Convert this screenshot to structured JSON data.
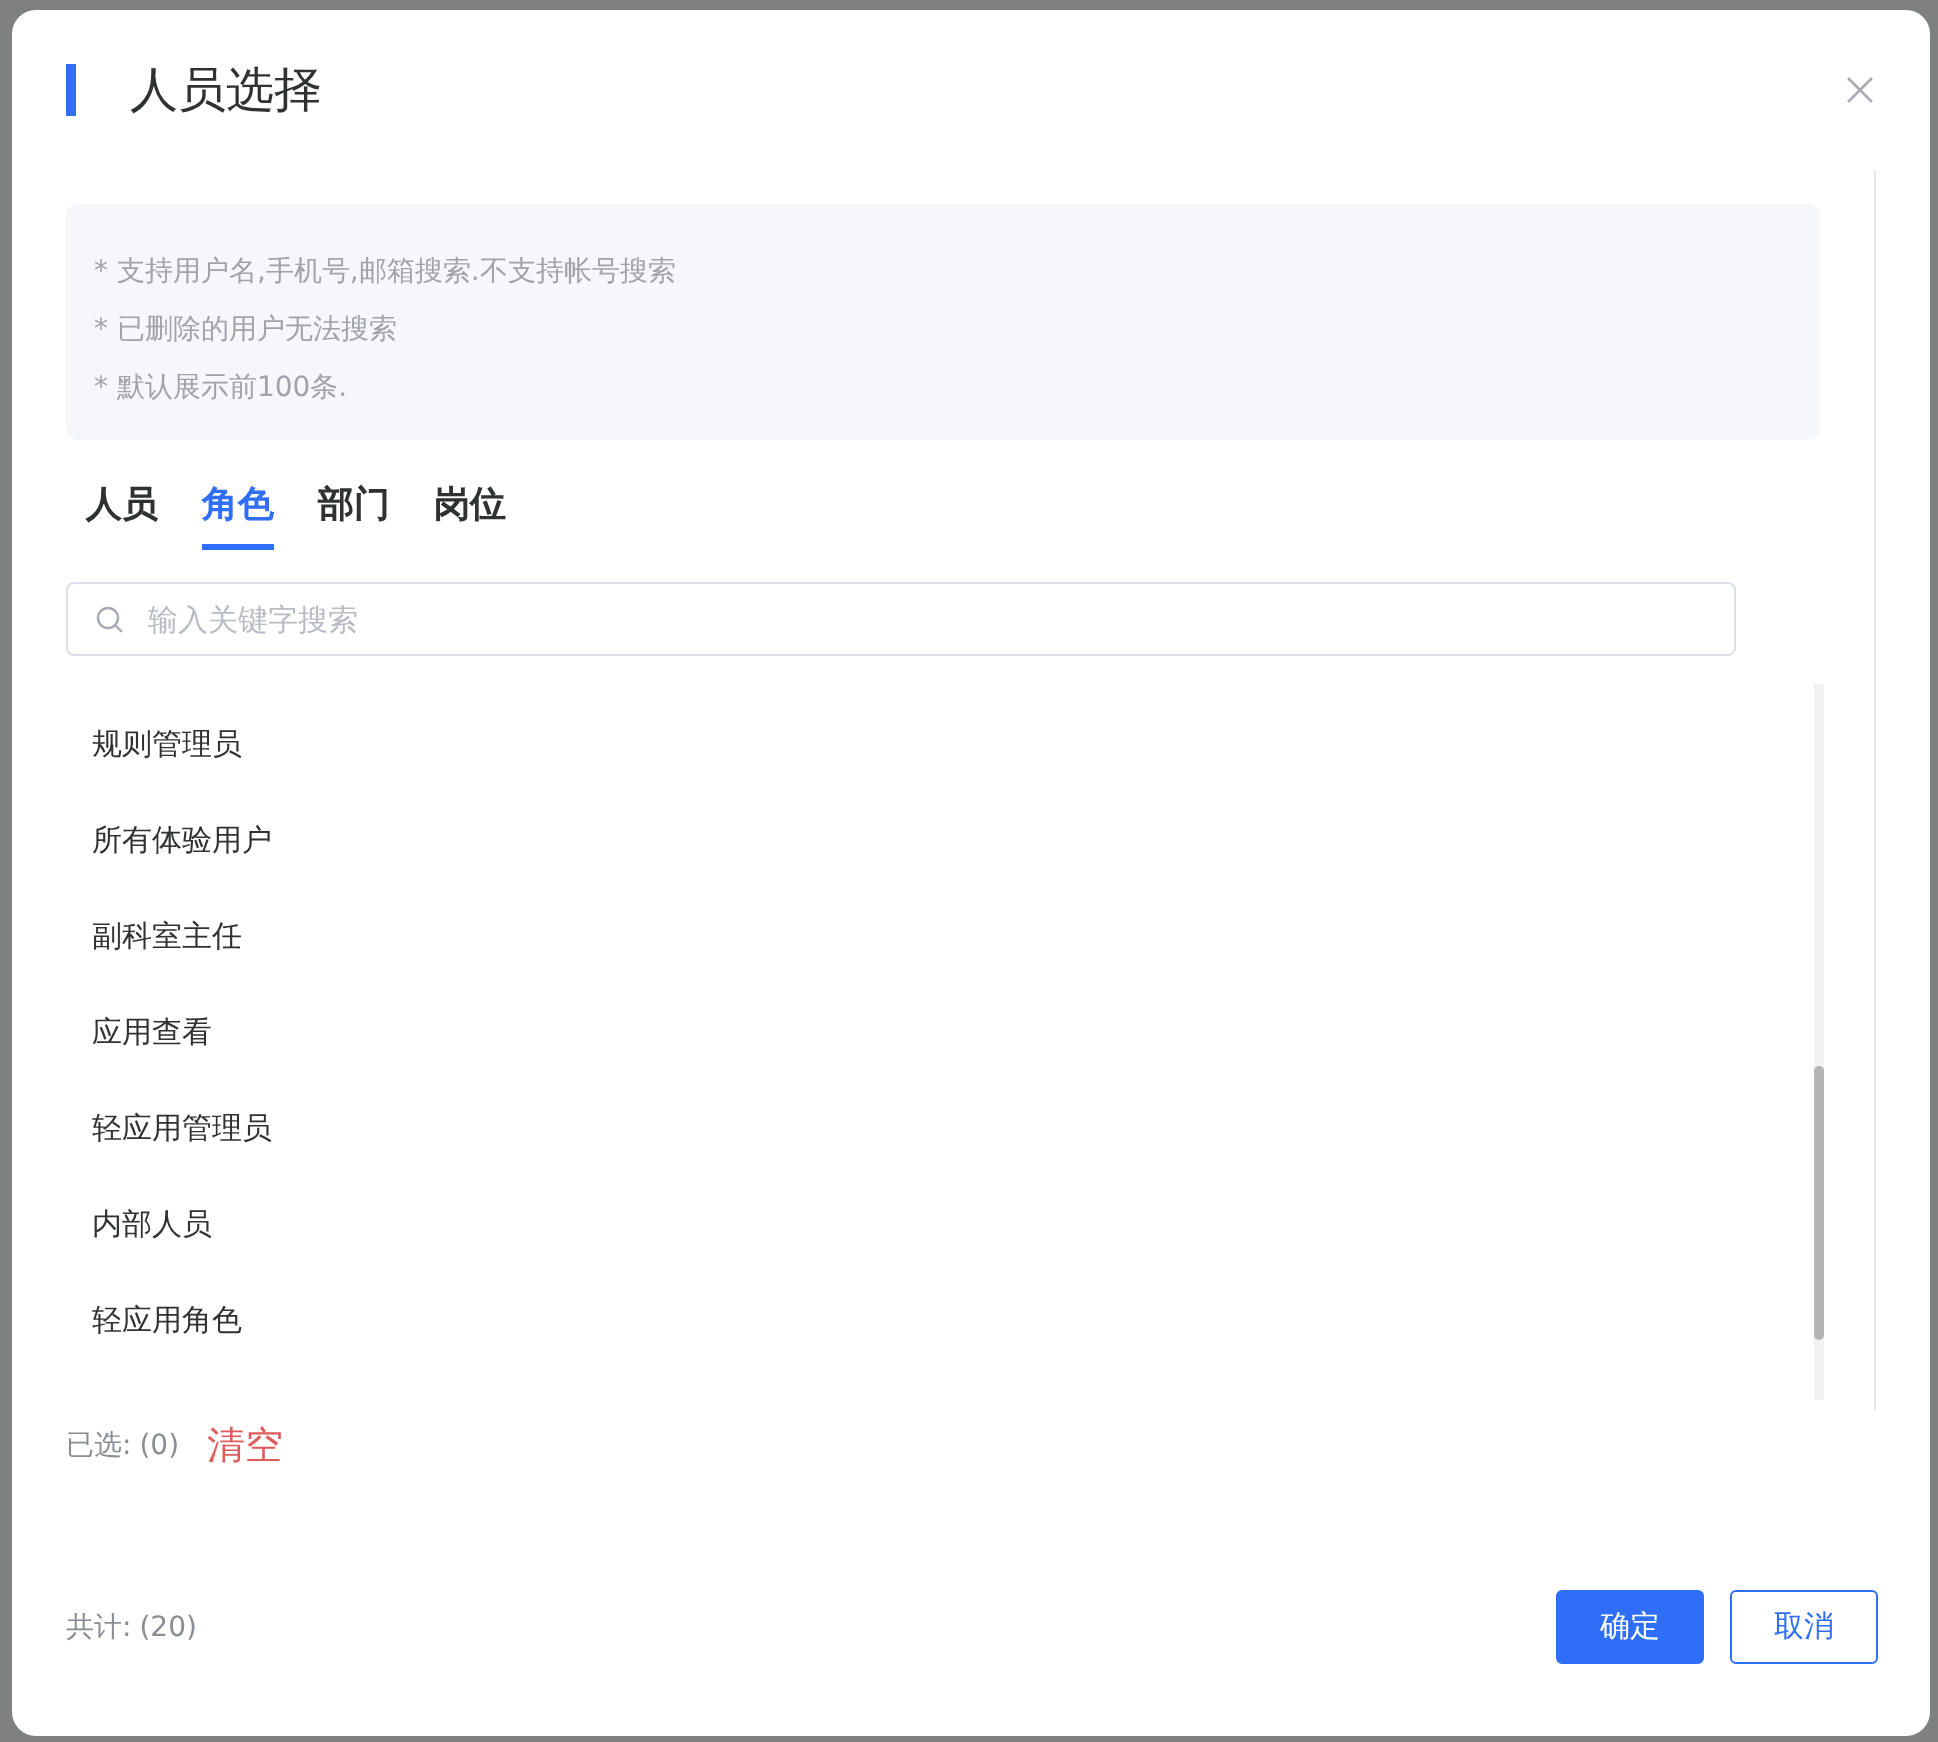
{
  "dialog": {
    "title": "人员选择"
  },
  "notes": [
    "* 支持用户名,手机号,邮箱搜索.不支持帐号搜索",
    "* 已删除的用户无法搜索",
    "* 默认展示前100条."
  ],
  "tabs": [
    {
      "label": "人员",
      "selected": false
    },
    {
      "label": "角色",
      "selected": true
    },
    {
      "label": "部门",
      "selected": false
    },
    {
      "label": "岗位",
      "selected": false
    }
  ],
  "search": {
    "placeholder": "输入关键字搜索"
  },
  "roles": [
    "规则管理员",
    "所有体验用户",
    "副科室主任",
    "应用查看",
    "轻应用管理员",
    "内部人员",
    "轻应用角色"
  ],
  "selection": {
    "label": "已选:",
    "count": "(0)",
    "clear": "清空"
  },
  "total": {
    "label": "共计:",
    "count": "(20)"
  },
  "buttons": [
    {
      "label": "确定",
      "kind": "primary"
    },
    {
      "label": "取消",
      "kind": "secondary"
    }
  ]
}
